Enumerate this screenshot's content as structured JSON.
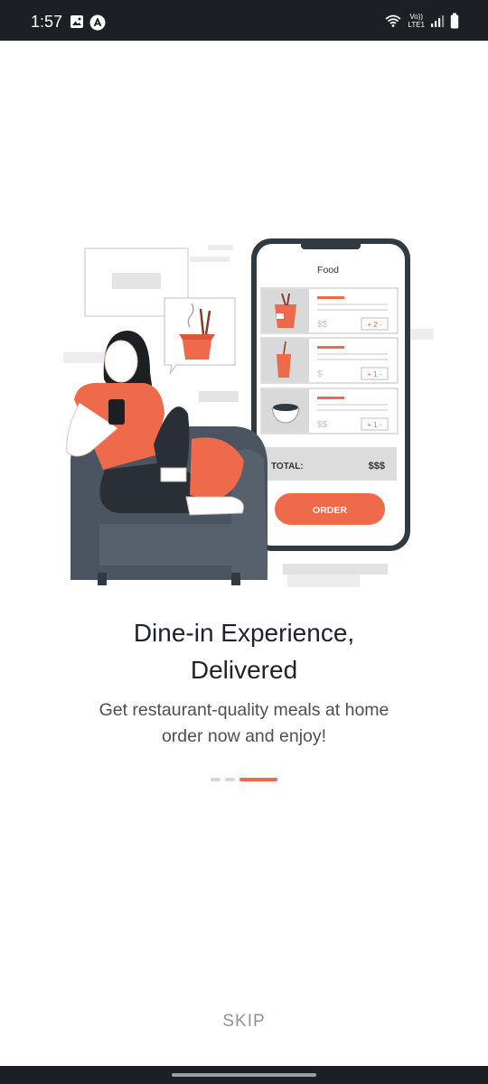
{
  "status_bar": {
    "time": "1:57",
    "network_top": "Vo))",
    "network_bottom": "LTE1",
    "icons": [
      "gallery-icon",
      "app-notification-icon",
      "wifi-icon",
      "signal-icon",
      "battery-icon"
    ]
  },
  "illustration": {
    "phone_header": "Food",
    "items": [
      {
        "price": "$$",
        "qty": "+ 2 -"
      },
      {
        "price": "$",
        "qty": "+ 1 -"
      },
      {
        "price": "$$",
        "qty": "+ 1 -"
      }
    ],
    "total_label": "TOTAL:",
    "total_value": "$$$",
    "order_label": "ORDER"
  },
  "onboarding": {
    "title_line1": "Dine-in Experience,",
    "title_line2": "Delivered",
    "subtitle_line1": "Get restaurant-quality meals at home",
    "subtitle_line2": "order now and enjoy!",
    "pages_total": 3,
    "active_page": 3
  },
  "skip_label": "SKIP",
  "colors": {
    "accent": "#ef6a4b",
    "dark": "#1c1f24",
    "chair": "#4b5561",
    "title": "#1d2130"
  }
}
